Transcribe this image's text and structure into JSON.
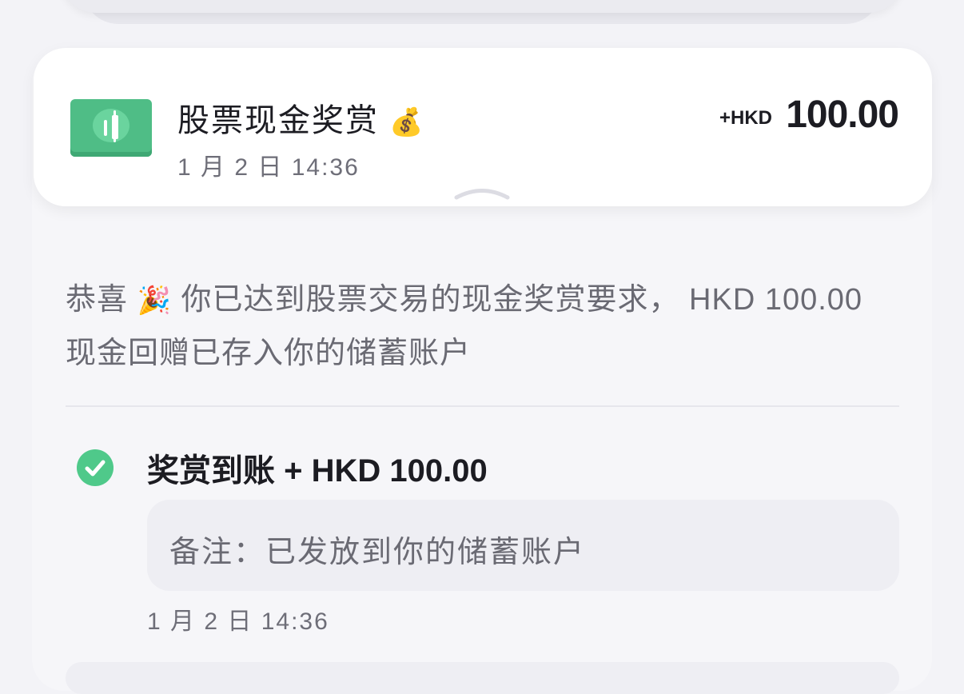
{
  "header": {
    "title": "股票现金奖赏",
    "title_emoji": "💰",
    "date": "1 月 2 日 14:36",
    "amount_prefix": "+HKD",
    "amount_value": "100.00"
  },
  "message": {
    "lead": "恭喜",
    "emoji": "🎉",
    "text": "你已达到股票交易的现金奖赏要求， HKD 100.00 现金回赠已存入你的储蓄账户"
  },
  "event": {
    "title": "奖赏到账 + HKD 100.00",
    "note": "备注：已发放到你的储蓄账户",
    "date": "1 月 2 日 14:36"
  },
  "colors": {
    "accent_green": "#4fc98a",
    "cash_green": "#4fbd86"
  },
  "icons": {
    "cash": "cash-icon",
    "money_bag": "money-bag-icon",
    "party_popper": "party-popper-icon",
    "check": "check-circle-icon",
    "chevron": "chevron-up-icon"
  }
}
